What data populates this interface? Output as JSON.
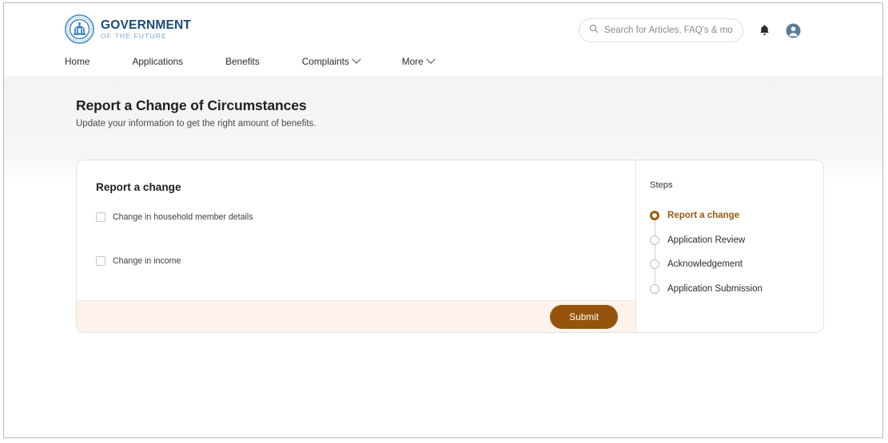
{
  "header": {
    "brand": {
      "icon": "government-seal-icon",
      "main": "GOVERNMENT",
      "sub": "OF THE FUTURE"
    },
    "search": {
      "icon": "search-icon",
      "placeholder": "Search for Articles, FAQ's & more",
      "value": ""
    },
    "actions": [
      {
        "icon": "bell-icon",
        "name": "notifications-button"
      },
      {
        "icon": "account-circle-icon",
        "name": "account-button"
      }
    ],
    "nav": [
      {
        "label": "Home",
        "has_caret": false
      },
      {
        "label": "Applications",
        "has_caret": false
      },
      {
        "label": "Benefits",
        "has_caret": false
      },
      {
        "label": "Complaints",
        "has_caret": true
      },
      {
        "label": "More",
        "has_caret": true
      }
    ]
  },
  "page": {
    "title": "Report a Change of Circumstances",
    "subtitle": "Update your information to get the right amount of benefits."
  },
  "form": {
    "title": "Report a change",
    "checkboxes": [
      {
        "label": "Change in household member details",
        "checked": false
      },
      {
        "label": "Change in income",
        "checked": false
      }
    ],
    "submit_label": "Submit"
  },
  "steps": {
    "title": "Steps",
    "items": [
      {
        "label": "Report a change",
        "state": "active"
      },
      {
        "label": "Application Review",
        "state": "inactive"
      },
      {
        "label": "Acknowledgement",
        "state": "inactive"
      },
      {
        "label": "Application Submission",
        "state": "inactive"
      }
    ]
  },
  "colors": {
    "accent_brown": "#96530b",
    "footer_peach": "#fdf3ec",
    "brand_blue": "#1b4a77",
    "brand_blue_light": "#7aa6cc"
  }
}
